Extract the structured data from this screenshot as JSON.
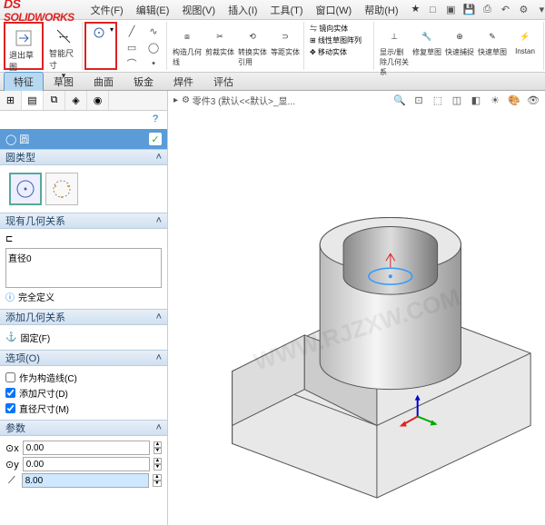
{
  "app": {
    "name": "SOLIDWORKS"
  },
  "menus": [
    "文件(F)",
    "编辑(E)",
    "视图(V)",
    "插入(I)",
    "工具(T)",
    "窗口(W)",
    "帮助(H)"
  ],
  "ribbon": {
    "exit_sketch": "退出草图",
    "smart_dim": "智能尺寸",
    "feature_labels": [
      "构造几何线",
      "剪裁实体",
      "转换实体引用",
      "等距实体",
      "镜向实体",
      "线性草图阵列",
      "移动实体",
      "显示/删除几何关系",
      "修复草图",
      "快速捕捉",
      "快速草图",
      "Instan"
    ]
  },
  "tabs": [
    "特征",
    "草图",
    "曲面",
    "钣金",
    "焊件",
    "评估"
  ],
  "active_tab": "特征",
  "pm": {
    "title": "圆",
    "section_circ_type": "圆类型",
    "section_existing_rel": "现有几何关系",
    "existing_item": "直径0",
    "full_def": "完全定义",
    "section_add_rel": "添加几何关系",
    "fix": "固定(F)",
    "section_options": "选项(O)",
    "opt_construction": "作为构造线(C)",
    "opt_add_dim": "添加尺寸(D)",
    "opt_diam_dim": "直径尺寸(M)",
    "section_params": "参数",
    "param_cx": "0.00",
    "param_cy": "0.00",
    "param_r": "8.00"
  },
  "viewport": {
    "partname": "零件3 (默认<<默认>_显..."
  },
  "watermark": "WWW.RJZXW.COM"
}
